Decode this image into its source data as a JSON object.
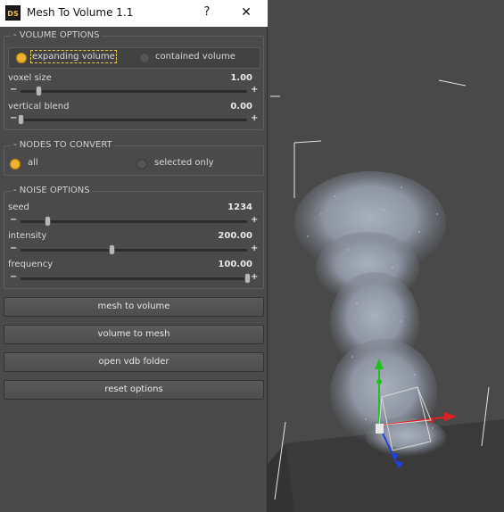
{
  "window": {
    "title": "Mesh To Volume 1.1",
    "app_icon_text": "DS",
    "help_glyph": "?",
    "close_glyph": "✕"
  },
  "volume_options": {
    "title": "- VOLUME OPTIONS",
    "radio": {
      "option_a": "expanding volume",
      "option_b": "contained volume",
      "selected": "expanding volume"
    },
    "params": [
      {
        "label": "voxel size",
        "value": "1.00",
        "fraction": 0.08
      },
      {
        "label": "vertical blend",
        "value": "0.00",
        "fraction": 0.0
      }
    ]
  },
  "nodes_to_convert": {
    "title": "- NODES TO CONVERT",
    "radio": {
      "option_a": "all",
      "option_b": "selected only",
      "selected": "all"
    }
  },
  "noise_options": {
    "title": "- NOISE OPTIONS",
    "params": [
      {
        "label": "seed",
        "value": "1234",
        "fraction": 0.12
      },
      {
        "label": "intensity",
        "value": "200.00",
        "fraction": 0.4
      },
      {
        "label": "frequency",
        "value": "100.00",
        "fraction": 1.0
      }
    ]
  },
  "buttons": {
    "mesh_to_volume": "mesh to volume",
    "volume_to_mesh": "volume to mesh",
    "open_vdb_folder": "open vdb folder",
    "reset_options": "reset options"
  },
  "colors": {
    "accent": "#f1b22b",
    "panel": "#4a4a4a",
    "viewport": "#494949",
    "gizmo_x": "#e02020",
    "gizmo_y": "#20c020",
    "gizmo_z": "#2040e0"
  },
  "icons": {
    "help": "question-mark-icon",
    "close": "close-icon",
    "app": "daz-studio-logo"
  }
}
